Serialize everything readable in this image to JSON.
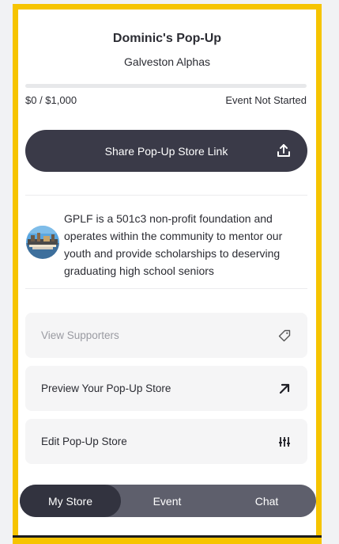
{
  "store": {
    "title": "Dominic's Pop-Up",
    "team": "Galveston Alphas",
    "progress_fraction": 0,
    "amount": "$0 / $1,000",
    "status": "Event Not Started"
  },
  "share": {
    "label": "Share Pop-Up Store Link",
    "icon": "share-upload-icon"
  },
  "about": {
    "description": "GPLF is a 501c3 non-profit foundation and operates within the community to mentor our youth and provide scholarships to deserving graduating high school seniors"
  },
  "actions": [
    {
      "label": "View Supporters",
      "icon": "tag-icon",
      "muted": true
    },
    {
      "label": "Preview Your Pop-Up Store",
      "icon": "arrow-up-right-icon"
    },
    {
      "label": "Edit Pop-Up Store",
      "icon": "sliders-icon"
    }
  ],
  "tabs": [
    {
      "label": "My Store",
      "active": true
    },
    {
      "label": "Event"
    },
    {
      "label": "Chat"
    }
  ],
  "colors": {
    "accent": "#f6c400",
    "dark": "#3a3a48",
    "tabbar": "#5e5f6c"
  }
}
